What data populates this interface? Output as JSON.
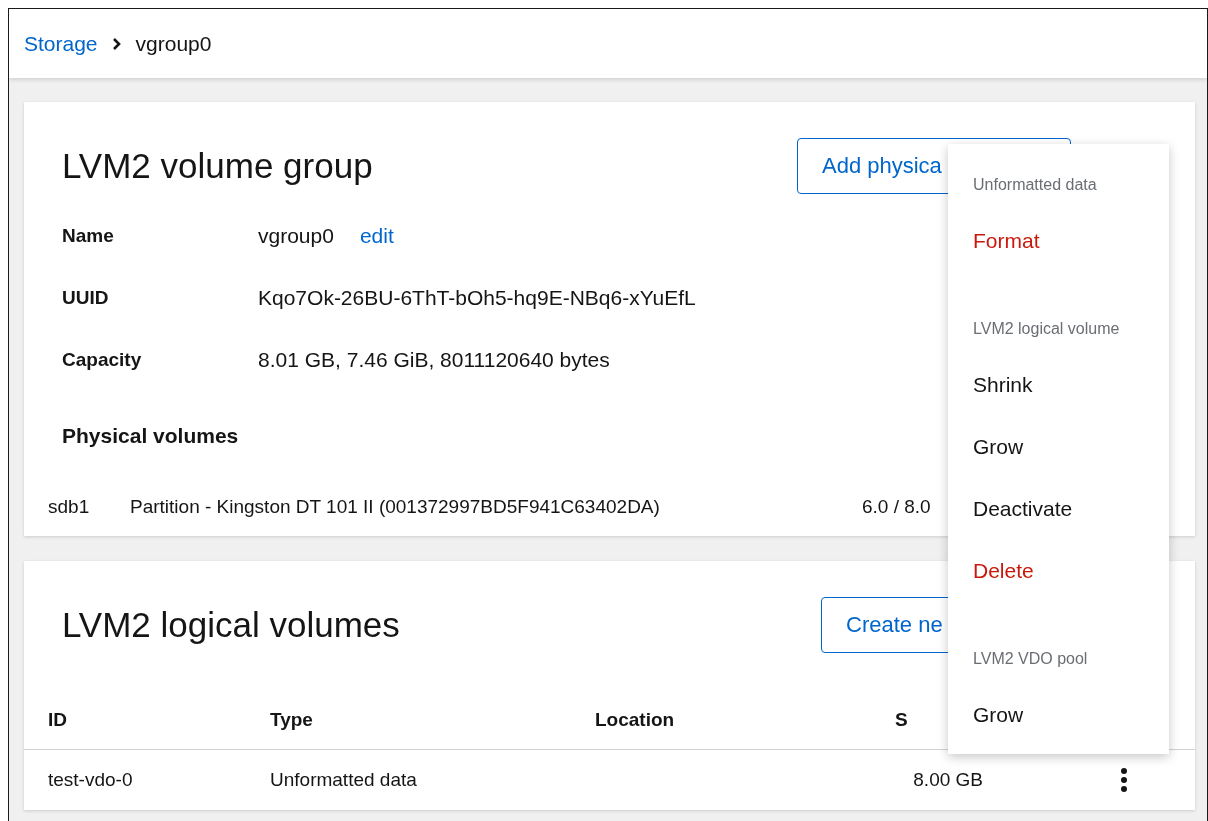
{
  "breadcrumb": {
    "link": "Storage",
    "current": "vgroup0"
  },
  "volume_group": {
    "title": "LVM2 volume group",
    "button": "Add physica",
    "fields": [
      {
        "label": "Name",
        "value": "vgroup0",
        "action": "edit"
      },
      {
        "label": "UUID",
        "value": "Kqo7Ok-26BU-6ThT-bOh5-hq9E-NBq6-xYuEfL"
      },
      {
        "label": "Capacity",
        "value": "8.01 GB, 7.46 GiB, 8011120640 bytes"
      }
    ],
    "physical_volumes": {
      "heading": "Physical volumes",
      "rows": [
        {
          "device": "sdb1",
          "description": "Partition - Kingston DT 101 II (001372997BD5F941C63402DA)",
          "usage": "6.0 / 8.0"
        }
      ]
    }
  },
  "logical_volumes": {
    "title": "LVM2 logical volumes",
    "button": "Create ne",
    "columns": [
      "ID",
      "Type",
      "Location",
      "S"
    ],
    "rows": [
      {
        "id": "test-vdo-0",
        "type": "Unformatted data",
        "location": "",
        "size": "8.00 GB"
      }
    ]
  },
  "menu": {
    "groups": [
      {
        "title": "Unformatted data",
        "items": [
          {
            "label": "Format",
            "kind": "danger"
          }
        ]
      },
      {
        "title": "LVM2 logical volume",
        "items": [
          {
            "label": "Shrink",
            "kind": "normal"
          },
          {
            "label": "Grow",
            "kind": "normal"
          },
          {
            "label": "Deactivate",
            "kind": "normal"
          },
          {
            "label": "Delete",
            "kind": "danger"
          }
        ]
      },
      {
        "title": "LVM2 VDO pool",
        "items": [
          {
            "label": "Grow",
            "kind": "normal"
          }
        ]
      }
    ]
  }
}
